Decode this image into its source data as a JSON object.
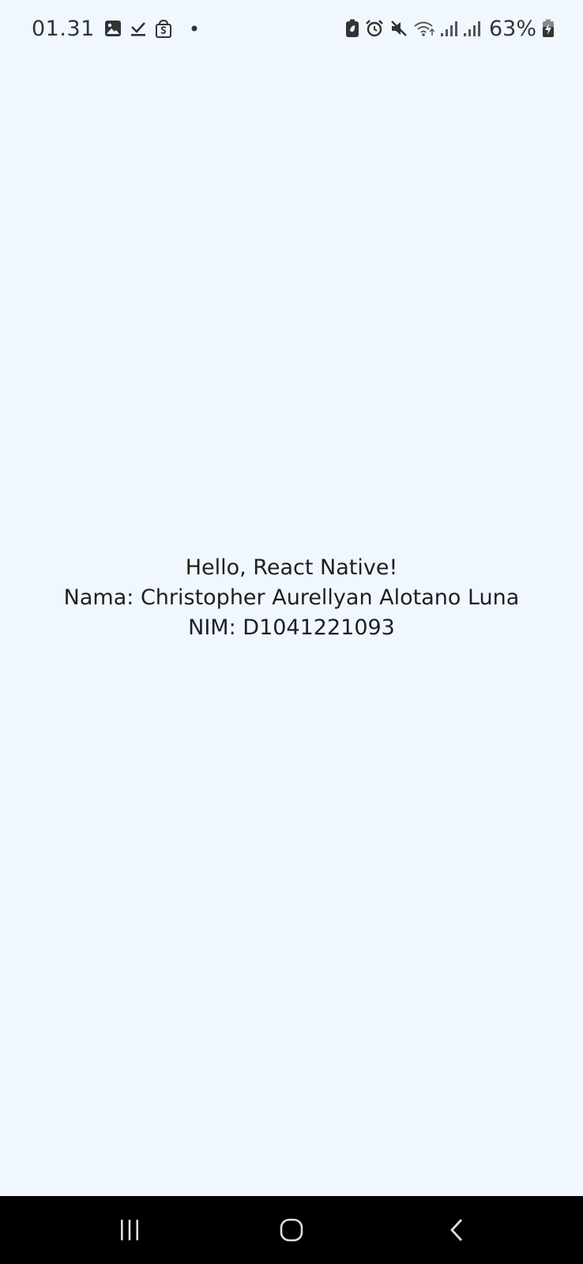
{
  "status_bar": {
    "time": "01.31",
    "left_icons": [
      "gallery-icon",
      "download-done-icon",
      "shopee-icon",
      "notification-dot-icon"
    ],
    "right_icons": [
      "battery-saver-icon",
      "alarm-icon",
      "mute-icon",
      "wifi-icon",
      "signal-icon",
      "signal-icon"
    ],
    "battery_percent": "63%"
  },
  "content": {
    "greeting": "Hello, React Native!",
    "name_line": "Nama: Christopher Aurellyan Alotano Luna",
    "nim_line": "NIM: D1041221093"
  },
  "nav_bar": {
    "buttons": [
      "recent-apps",
      "home",
      "back"
    ]
  },
  "colors": {
    "background": "#f0f7ff",
    "nav_background": "#000000",
    "text": "#1f1f1f"
  }
}
